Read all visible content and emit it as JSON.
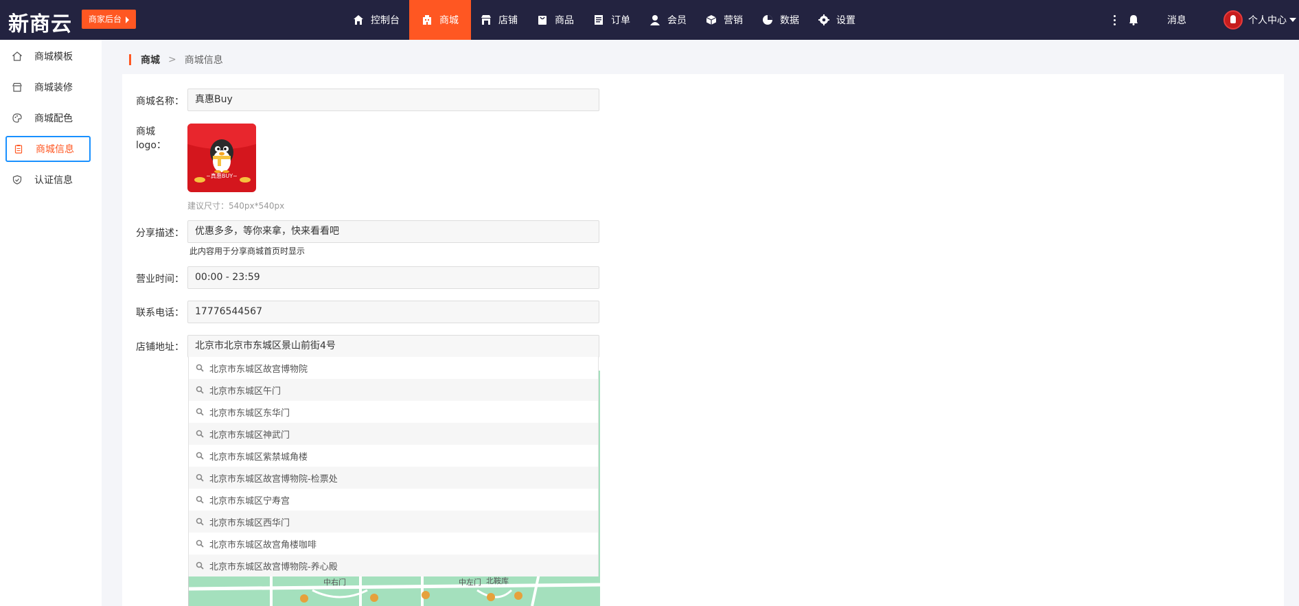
{
  "header": {
    "logo_text": "新商云",
    "merchant_button": "商家后台",
    "nav": [
      {
        "label": "控制台",
        "icon": "home-icon",
        "active": false
      },
      {
        "label": "商城",
        "icon": "shop-building-icon",
        "active": true
      },
      {
        "label": "店铺",
        "icon": "store-icon",
        "active": false
      },
      {
        "label": "商品",
        "icon": "shopping-bag-icon",
        "active": false
      },
      {
        "label": "订单",
        "icon": "order-list-icon",
        "active": false
      },
      {
        "label": "会员",
        "icon": "user-icon",
        "active": false
      },
      {
        "label": "营销",
        "icon": "cube-icon",
        "active": false
      },
      {
        "label": "数据",
        "icon": "pie-chart-icon",
        "active": false
      },
      {
        "label": "设置",
        "icon": "gear-icon",
        "active": false
      }
    ],
    "message_label": "消息",
    "user_center_label": "个人中心"
  },
  "sidebar": {
    "items": [
      {
        "label": "商城模板",
        "icon": "home-outline-icon"
      },
      {
        "label": "商城装修",
        "icon": "storefront-icon"
      },
      {
        "label": "商城配色",
        "icon": "palette-icon"
      },
      {
        "label": "商城信息",
        "icon": "clipboard-icon",
        "active": true
      },
      {
        "label": "认证信息",
        "icon": "shield-check-icon"
      }
    ]
  },
  "breadcrumb": {
    "root": "商城",
    "separator": ">",
    "current": "商城信息"
  },
  "form": {
    "name_label": "商城名称：",
    "name_value": "真惠Buy",
    "logo_label": "商城logo：",
    "logo_image_text": "~真惠BUY~",
    "logo_hint": "建议尺寸：540px*540px",
    "share_label": "分享描述：",
    "share_value": "优惠多多，等你来拿，快来看看吧",
    "share_hint": "此内容用于分享商城首页时显示",
    "hours_label": "营业时间：",
    "hours_value": "00:00 - 23:59",
    "phone_label": "联系电话：",
    "phone_value": "17776544567",
    "address_label": "店铺地址：",
    "address_value": "北京市北京市东城区景山前街4号"
  },
  "suggestions": [
    "北京市东城区故宫博物院",
    "北京市东城区午门",
    "北京市东城区东华门",
    "北京市东城区神武门",
    "北京市东城区紫禁城角楼",
    "北京市东城区故宫博物院-检票处",
    "北京市东城区宁寿宫",
    "北京市东城区西华门",
    "北京市东城区故宫角楼咖啡",
    "北京市东城区故宫博物院-养心殿"
  ],
  "map": {
    "labels": [
      "中右门",
      "中左门",
      "北鞍库"
    ]
  },
  "colors": {
    "topbar": "#232340",
    "accent": "#ff5722",
    "selection_border": "#1890ff"
  }
}
